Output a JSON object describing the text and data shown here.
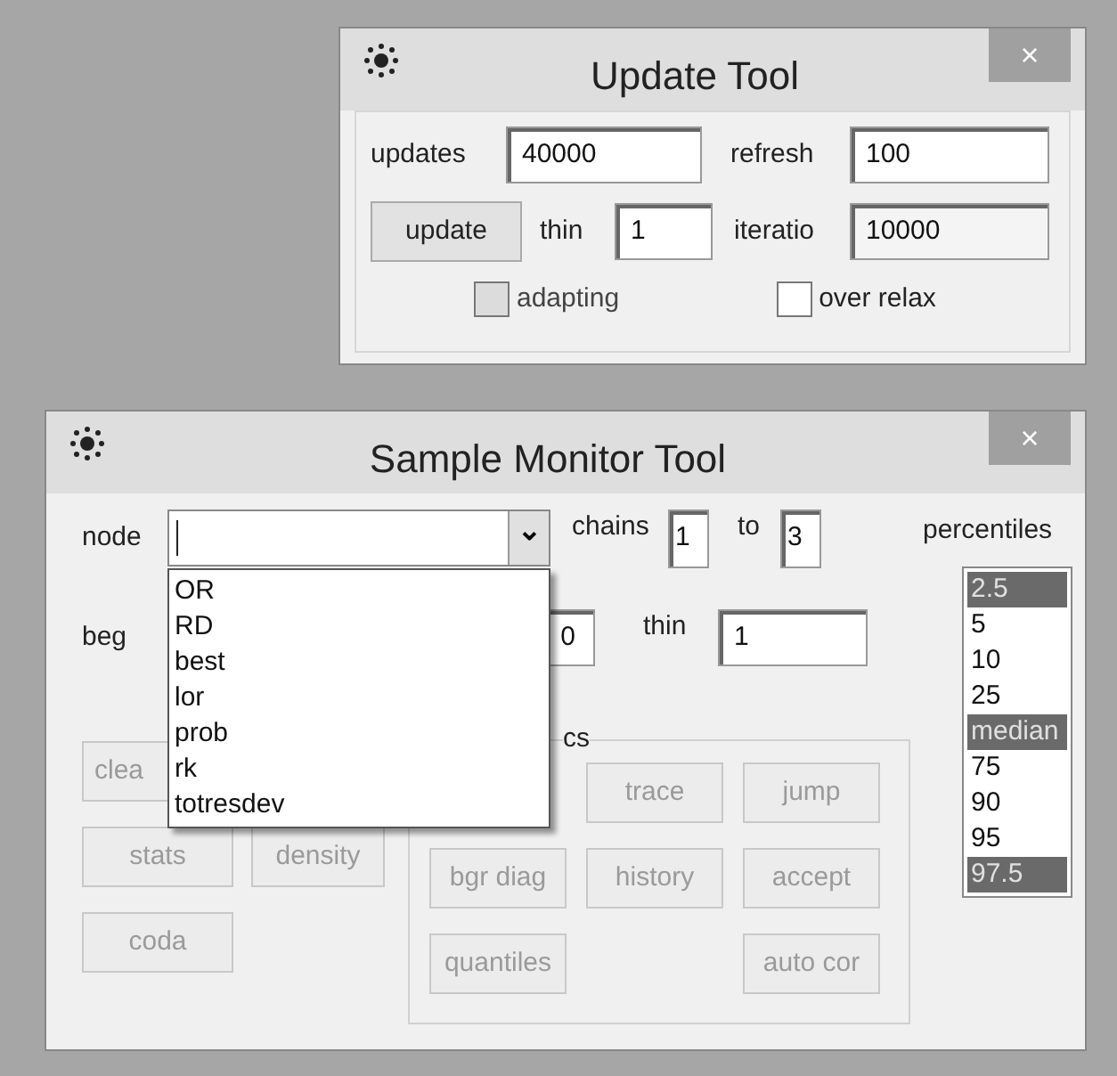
{
  "update_tool": {
    "title": "Update Tool",
    "close": "×",
    "updates": {
      "label": "updates",
      "value": "40000"
    },
    "refresh": {
      "label": "refresh",
      "value": "100"
    },
    "update_button": "update",
    "thin": {
      "label": "thin",
      "value": "1"
    },
    "iteration": {
      "label": "iteratio",
      "value": "10000"
    },
    "checkboxes": [
      {
        "label": "adapting",
        "checked": false,
        "disabled": true
      },
      {
        "label": "over relax",
        "checked": false,
        "disabled": false
      }
    ]
  },
  "sample_monitor": {
    "title": "Sample Monitor Tool",
    "close": "×",
    "node": {
      "label": "node",
      "arrow": "⌄"
    },
    "chains": {
      "label": "chains",
      "from": "1",
      "to_label": "to",
      "to": "3"
    },
    "beg": {
      "label": "beg",
      "value": "0"
    },
    "thin": {
      "label": "thin",
      "value": "1"
    },
    "statistics_label": "cs",
    "left_buttons": [
      {
        "label": "clea",
        "disabled": true
      },
      {
        "label": "stats",
        "disabled": true
      },
      {
        "label": "density",
        "disabled": true
      },
      {
        "label": "coda",
        "disabled": true
      }
    ],
    "frame_buttons": [
      {
        "label": "trace",
        "disabled": true
      },
      {
        "label": "jump",
        "disabled": true
      },
      {
        "label": "bgr diag",
        "disabled": true
      },
      {
        "label": "history",
        "disabled": true
      },
      {
        "label": "accept",
        "disabled": true
      },
      {
        "label": "quantiles",
        "disabled": true
      },
      {
        "label": "auto cor",
        "disabled": true
      }
    ],
    "percentiles": {
      "label": "percentiles",
      "items": [
        {
          "label": "2.5",
          "selected": true
        },
        {
          "label": "5",
          "selected": false
        },
        {
          "label": "10",
          "selected": false
        },
        {
          "label": "25",
          "selected": false
        },
        {
          "label": "median",
          "selected": true
        },
        {
          "label": "75",
          "selected": false
        },
        {
          "label": "90",
          "selected": false
        },
        {
          "label": "95",
          "selected": false
        },
        {
          "label": "97.5",
          "selected": true
        }
      ]
    },
    "node_options": [
      "OR",
      "RD",
      "best",
      "lor",
      "prob",
      "rk",
      "totresdev"
    ]
  }
}
